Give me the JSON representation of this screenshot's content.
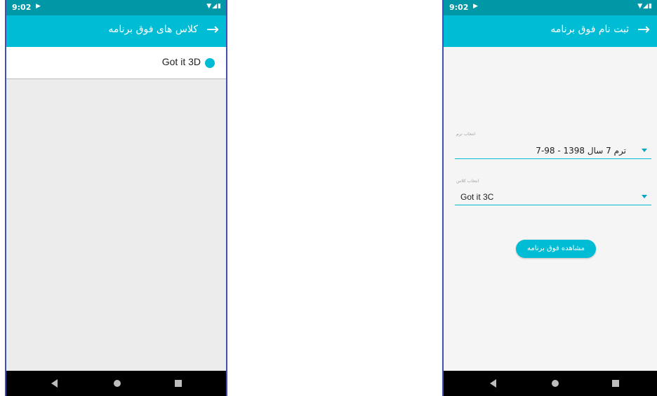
{
  "left_phone": {
    "status_bar": {
      "time": "9:02",
      "play_icon": "play-protect-icon",
      "system_icons": "wifi-signal-battery"
    },
    "app_bar": {
      "title": "کلاس های فوق برنامه",
      "back_icon": "arrow-right-icon"
    },
    "list": [
      {
        "label": "Got it 3D",
        "icon": "dot-icon",
        "icon_color": "#00bcd4"
      }
    ],
    "nav": {
      "back": "nav-back-icon",
      "home": "nav-home-icon",
      "recent": "nav-recent-icon"
    }
  },
  "right_phone": {
    "status_bar": {
      "time": "9:02",
      "play_icon": "play-protect-icon",
      "system_icons": "wifi-signal-battery"
    },
    "app_bar": {
      "title": "ثبت نام فوق برنامه",
      "back_icon": "arrow-right-icon"
    },
    "form": {
      "term_label": "انتخاب ترم",
      "term_value": "ترم 7 سال 1398 - 98-7",
      "class_label": "انتخاب کلاس",
      "class_value": "Got it 3C",
      "view_button": "مشاهده فوق برنامه"
    },
    "nav": {
      "back": "nav-back-icon",
      "home": "nav-home-icon",
      "recent": "nav-recent-icon"
    }
  },
  "colors": {
    "primary": "#00bcd4",
    "primary_dark": "#0097a7",
    "frame_border": "#3f51b5",
    "nav_bar": "#000000"
  }
}
